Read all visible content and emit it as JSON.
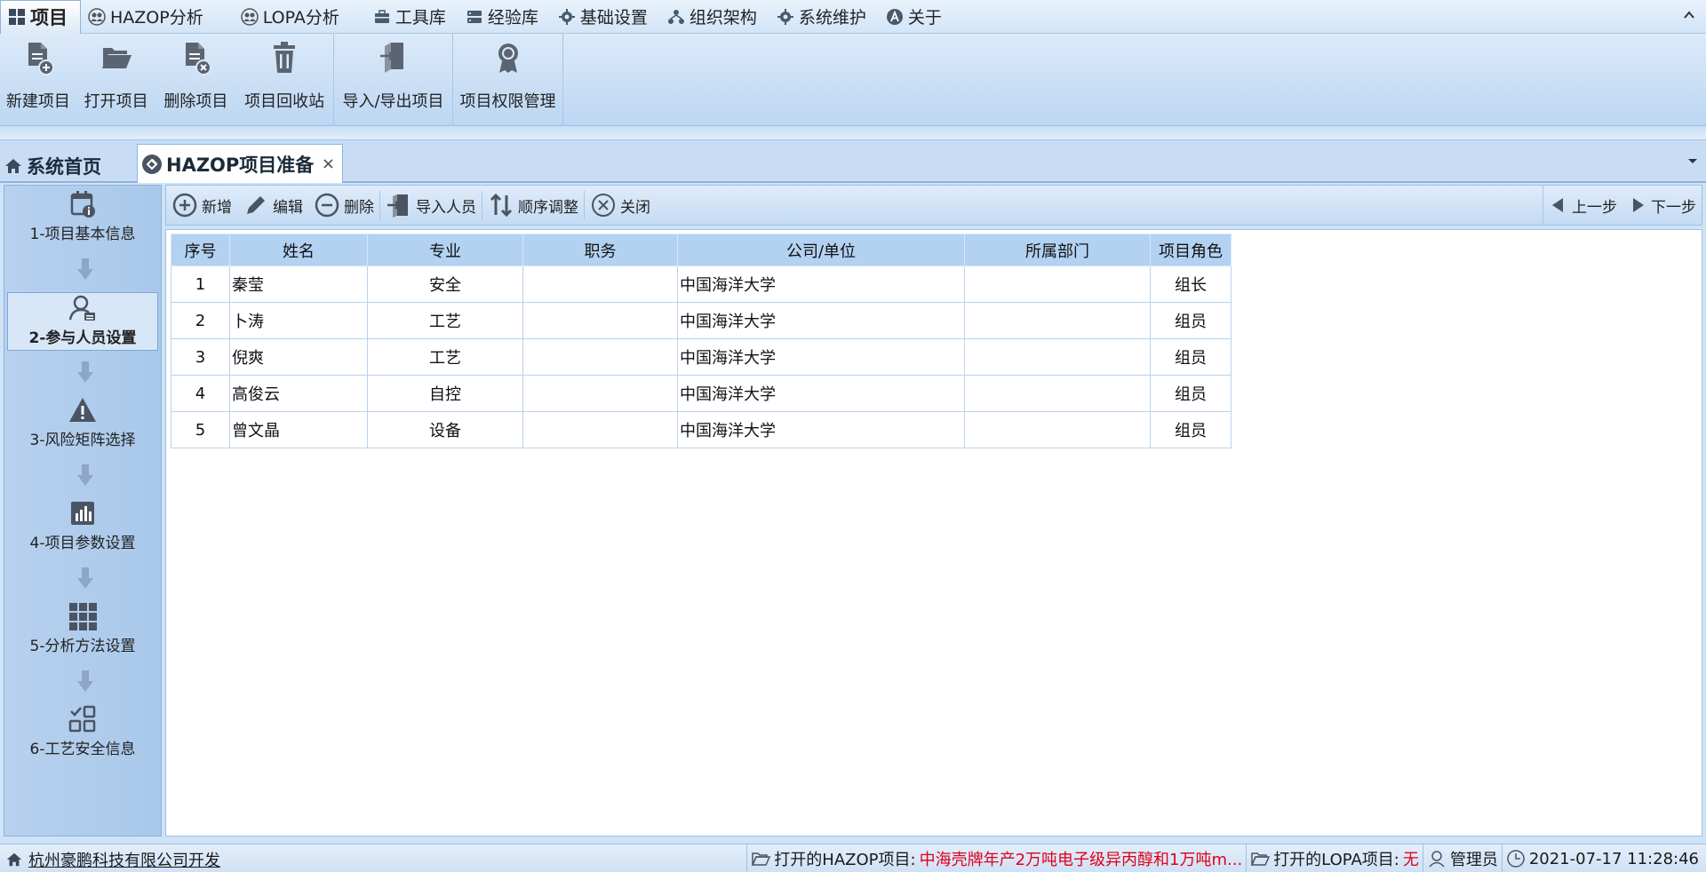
{
  "menubar": {
    "items": [
      {
        "label": "项目",
        "icon": "grid-icon",
        "active": true
      },
      {
        "label": "HAZOP分析",
        "icon": "people-icon"
      },
      {
        "label": "LOPA分析",
        "icon": "people-icon"
      },
      {
        "label": "工具库",
        "icon": "toolbox-icon"
      },
      {
        "label": "经验库",
        "icon": "database-icon"
      },
      {
        "label": "基础设置",
        "icon": "gear-icon"
      },
      {
        "label": "组织架构",
        "icon": "org-icon"
      },
      {
        "label": "系统维护",
        "icon": "gear-icon"
      },
      {
        "label": "关于",
        "icon": "about-icon"
      }
    ]
  },
  "ribbon": {
    "buttons": [
      {
        "label": "新建项目",
        "icon": "new-file-icon"
      },
      {
        "label": "打开项目",
        "icon": "folder-open-icon"
      },
      {
        "label": "删除项目",
        "icon": "delete-file-icon"
      },
      {
        "label": "项目回收站",
        "icon": "trash-icon"
      },
      {
        "label": "导入/导出项目",
        "icon": "import-export-icon"
      },
      {
        "label": "项目权限管理",
        "icon": "permission-icon"
      }
    ]
  },
  "tabs": {
    "home": "系统首页",
    "doc": "HAZOP项目准备",
    "close": "×"
  },
  "steps": [
    {
      "label": "1-项目基本信息",
      "icon": "calendar-info-icon"
    },
    {
      "label": "2-参与人员设置",
      "icon": "user-list-icon",
      "active": true
    },
    {
      "label": "3-风险矩阵选择",
      "icon": "warning-icon"
    },
    {
      "label": "4-项目参数设置",
      "icon": "bar-chart-icon"
    },
    {
      "label": "5-分析方法设置",
      "icon": "grid-9-icon"
    },
    {
      "label": "6-工艺安全信息",
      "icon": "apps-icon"
    }
  ],
  "toolbar": {
    "add": "新增",
    "edit": "编辑",
    "delete": "删除",
    "import": "导入人员",
    "reorder": "顺序调整",
    "close": "关闭",
    "prev": "上一步",
    "next": "下一步"
  },
  "table": {
    "headers": [
      "序号",
      "姓名",
      "专业",
      "职务",
      "公司/单位",
      "所属部门",
      "项目角色"
    ],
    "rows": [
      [
        "1",
        "秦莹",
        "安全",
        "",
        "中国海洋大学",
        "",
        "组长"
      ],
      [
        "2",
        "卜涛",
        "工艺",
        "",
        "中国海洋大学",
        "",
        "组员"
      ],
      [
        "3",
        "倪爽",
        "工艺",
        "",
        "中国海洋大学",
        "",
        "组员"
      ],
      [
        "4",
        "高俊云",
        "自控",
        "",
        "中国海洋大学",
        "",
        "组员"
      ],
      [
        "5",
        "曾文晶",
        "设备",
        "",
        "中国海洋大学",
        "",
        "组员"
      ]
    ]
  },
  "statusbar": {
    "company": "杭州豪鹏科技有限公司开发",
    "hazop_label": "打开的HAZOP项目:",
    "hazop_value": "中海壳牌年产2万吨电子级异丙醇和1万吨m...",
    "lopa_label": "打开的LOPA项目:",
    "lopa_value": "无",
    "user": "管理员",
    "datetime": "2021-07-17 11:28:46"
  }
}
